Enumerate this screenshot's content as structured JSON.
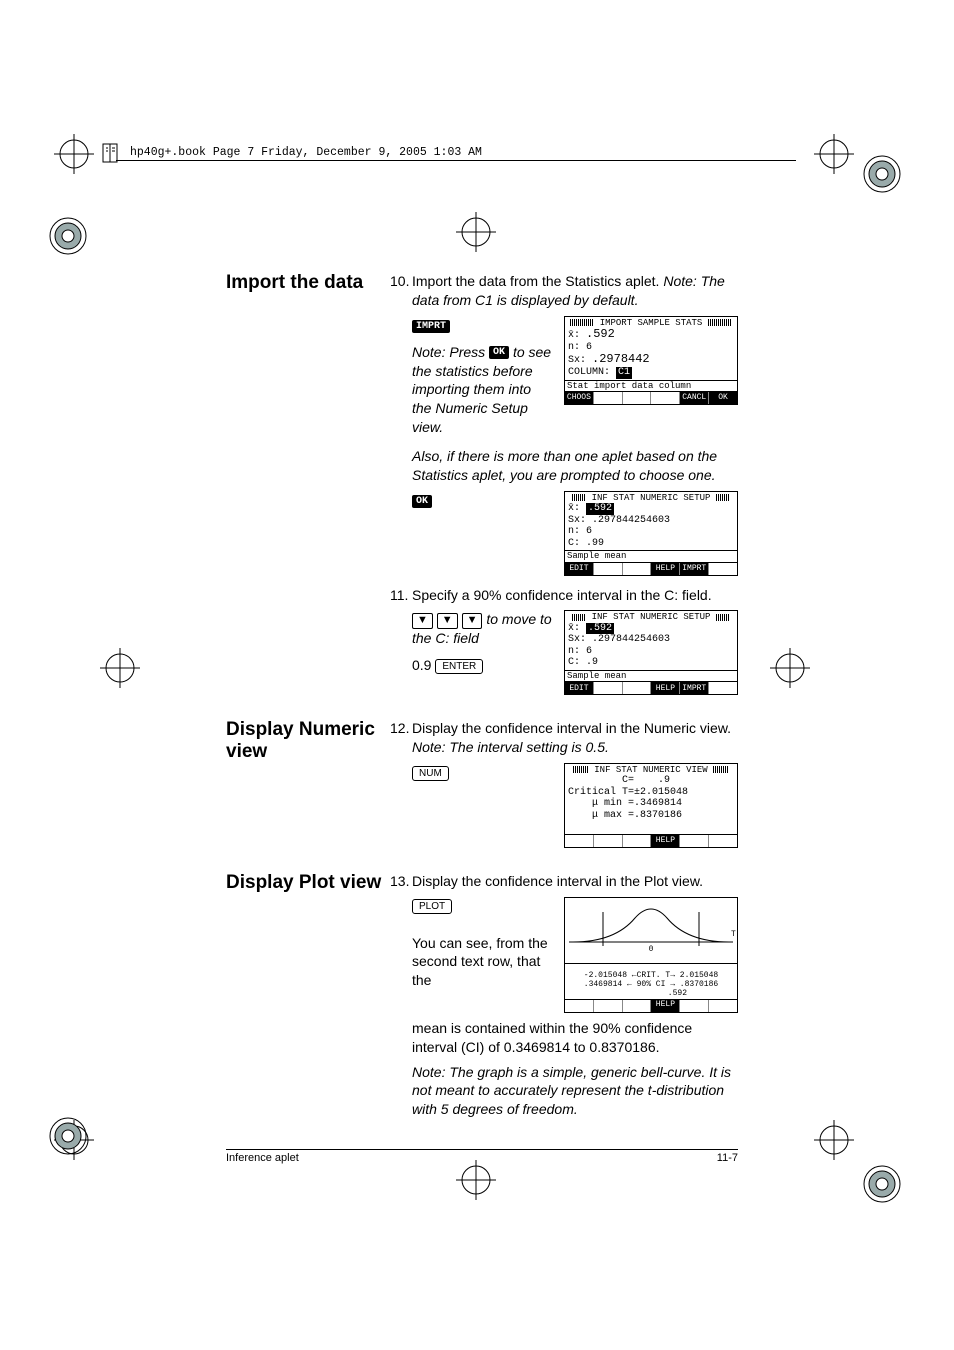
{
  "header": {
    "runhead": "hp40g+.book  Page 7  Friday, December 9, 2005  1:03 AM"
  },
  "sections": {
    "import": {
      "heading": "Import the data",
      "step10_num": "10.",
      "step10": "Import the data from the Statistics aplet. ",
      "step10_note": "Note: The data from C1 is displayed by default.",
      "imprt_key": "IMPRT",
      "note_press_pre": "Note: Press ",
      "ok_key": "OK",
      "note_press_post": " to see the statistics before importing them into the Numeric Setup view.",
      "also": "Also, if there is more than one aplet based on the Statistics aplet, you are prompted to choose one.",
      "step11_num": "11.",
      "step11": "Specify a 90% confidence interval in the C: field.",
      "arrows_note": " to move to the C: field",
      "value_09": "0.9",
      "enter_key": "ENTER"
    },
    "numeric": {
      "heading": "Display Numeric view",
      "step12_num": "12.",
      "step12": "Display the confidence interval in the Numeric view. ",
      "step12_note": "Note: The interval setting is 0.5.",
      "num_key": "NUM"
    },
    "plot": {
      "heading": "Display Plot view",
      "step13_num": "13.",
      "step13": "Display the confidence interval in the Plot view.",
      "plot_key": "PLOT",
      "body": "You can see, from the second text row, that the mean is contained within the 90% confidence interval (CI) of 0.3469814 to 0.8370186.",
      "note": "Note: The graph is a simple, generic bell-curve. It is not meant to accurately represent the t-distribution with 5 degrees of freedom."
    }
  },
  "lcd": {
    "import": {
      "title": "IMPORT SAMPLE STATS",
      "l1a": "x̄: ",
      "l1b": ".592",
      "l2": "n: 6",
      "l3a": "Sx: ",
      "l3b": ".2978442",
      "l4a": "COLUMN: ",
      "l4b": "C1",
      "status": "Stat import data column",
      "fk1": "CHOOS",
      "fk5": "CANCL",
      "fk6": "OK"
    },
    "setup1": {
      "title": "INF STAT NUMERIC SETUP",
      "l1a": "x̄: ",
      "l1b": ".592",
      "l2": "Sx: .297844254603",
      "l3": "n: 6",
      "l4": "C: .99",
      "status": "Sample mean",
      "fk1": "EDIT",
      "fk4": "HELP",
      "fk5": "IMPRT"
    },
    "setup2": {
      "title": "INF STAT NUMERIC SETUP",
      "l1a": "x̄: ",
      "l1b": ".592",
      "l2": "Sx: .297844254603",
      "l3": "n: 6",
      "l4": "C: .9",
      "status": "Sample mean",
      "fk1": "EDIT",
      "fk4": "HELP",
      "fk5": "IMPRT"
    },
    "numview": {
      "title": "INF STAT NUMERIC VIEW",
      "l1": "         C=    .9",
      "l2": "Critical T=±2.015048",
      "l3": "    μ min =.3469814",
      "l4": "    μ max =.8370186",
      "fk4": "HELP"
    },
    "plotview": {
      "row1": "-2.015048 ←CRIT. T→ 2.015048",
      "row2": ".3469814 ← 90% CI → .8370186",
      "row3": "           .592",
      "fk4": "HELP"
    }
  },
  "footer": {
    "left": "Inference aplet",
    "right": "11-7"
  },
  "chart_data": {
    "type": "line",
    "title": "t-distribution confidence interval plot (generic bell curve)",
    "critical_t": [
      -2.015048,
      2.015048
    ],
    "ci_bounds": [
      0.3469814,
      0.8370186
    ],
    "mean": 0.592,
    "confidence": 0.9,
    "xlabel": "T",
    "ylabel": ""
  }
}
